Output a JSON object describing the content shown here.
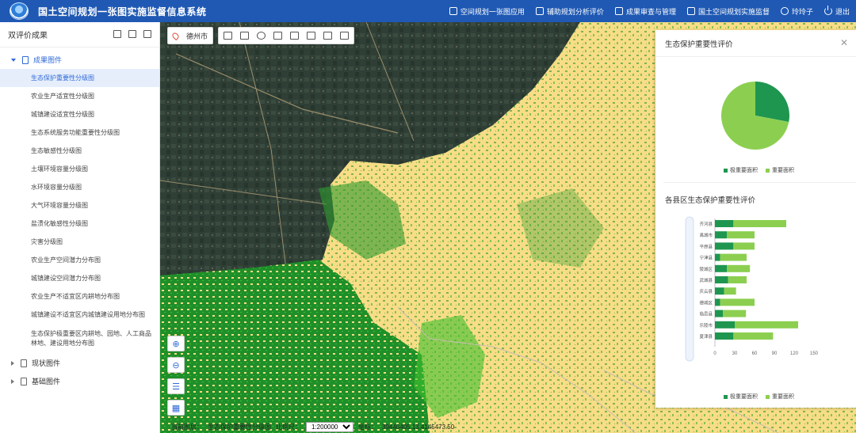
{
  "header": {
    "title": "国土空间规划一张图实施监督信息系统",
    "nav": [
      {
        "label": "空间规划一张图应用",
        "icon": "map-icon"
      },
      {
        "label": "辅助规划分析评价",
        "icon": "analysis-icon"
      },
      {
        "label": "成果审查与管理",
        "icon": "review-icon"
      },
      {
        "label": "国土空间规划实施监督",
        "icon": "supervision-icon"
      },
      {
        "label": "玲玲子",
        "icon": "user-icon"
      },
      {
        "label": "退出",
        "icon": "power-icon"
      }
    ]
  },
  "sidebar": {
    "title": "双评价成果",
    "groups": [
      {
        "label": "成果图件",
        "items": [
          "生态保护重要性分级图",
          "农业生产适宜性分级图",
          "城镇建设适宜性分级图",
          "生态系统服务功能重要性分级图",
          "生态敏感性分级图",
          "土壤环境容量分级图",
          "水环境容量分级图",
          "大气环境容量分级图",
          "盐渍化敏感性分级图",
          "灾害分级图",
          "农业生产空间潜力分布图",
          "城镇建设空间潜力分布图",
          "农业生产不适宜区内耕地分布图",
          "城镇建设不适宜区内城镇建设用地分布图",
          "生态保护极重要区内耕地、园地、人工商品林地、建设用地分布图"
        ]
      },
      {
        "label": "现状图件"
      },
      {
        "label": "基础图件"
      }
    ]
  },
  "map": {
    "city": "德州市",
    "status": {
      "layer_label": "当前图层：",
      "layer": "生态保护重要性分级图",
      "scale_label": "比例尺：",
      "scale": "1:200000",
      "coord_label": "坐标：",
      "coord": "39440405.13,4145473.50"
    }
  },
  "panel": {
    "title": "生态保护重要性评价",
    "section2_title": "各县区生态保护重要性评价",
    "colors": {
      "dark": "#1e9650",
      "light": "#8ccf50"
    }
  },
  "chart_data": [
    {
      "type": "pie",
      "series": [
        {
          "name": "极重要面积",
          "value": 28
        },
        {
          "name": "重要面积",
          "value": 72
        }
      ],
      "legend": "bottom"
    },
    {
      "type": "bar",
      "orientation": "horizontal",
      "stacked": true,
      "categories": [
        "齐河县",
        "禹城市",
        "平原县",
        "宁津县",
        "陵城区",
        "武城县",
        "庆云县",
        "德城区",
        "临邑县",
        "乐陵市",
        "夏津县"
      ],
      "series": [
        {
          "name": "极重要面积",
          "values": [
            28,
            18,
            28,
            8,
            18,
            20,
            14,
            8,
            12,
            30,
            28
          ]
        },
        {
          "name": "重要面积",
          "values": [
            80,
            42,
            32,
            40,
            35,
            28,
            18,
            52,
            35,
            96,
            60
          ]
        }
      ],
      "xticks": [
        0,
        30,
        60,
        90,
        120,
        150
      ],
      "xlim": [
        0,
        150
      ],
      "legend": "bottom"
    }
  ]
}
